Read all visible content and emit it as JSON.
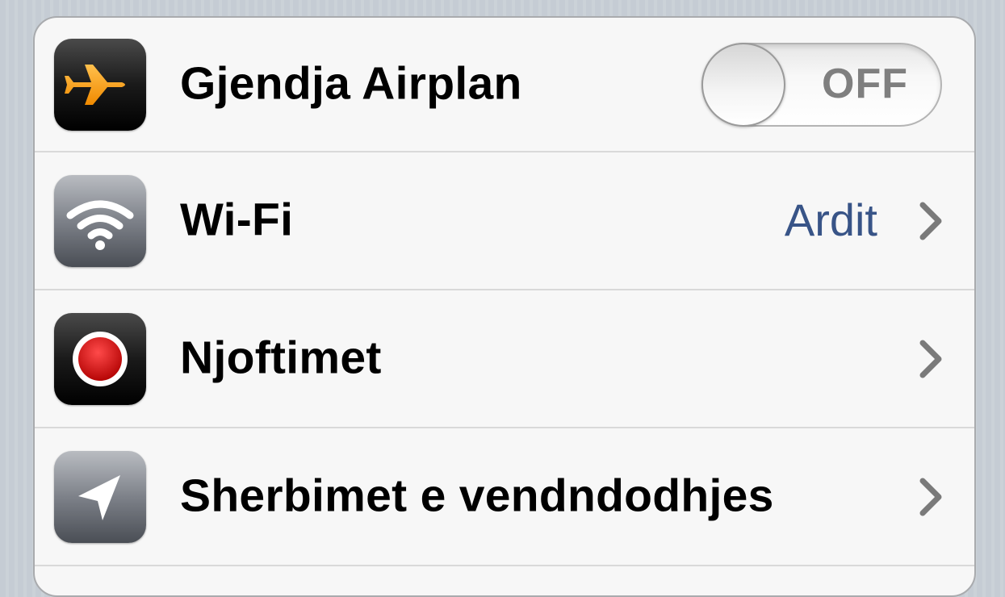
{
  "settings": {
    "rows": [
      {
        "label": "Gjendja Airplan",
        "icon": "airplane-icon",
        "control": "toggle",
        "toggle_state_label": "OFF",
        "toggle_on": false
      },
      {
        "label": "Wi-Fi",
        "icon": "wifi-icon",
        "detail": "Ardit",
        "control": "disclosure"
      },
      {
        "label": "Njoftimet",
        "icon": "notifications-icon",
        "control": "disclosure"
      },
      {
        "label": "Sherbimet e vendndodhjes",
        "icon": "location-arrow-icon",
        "control": "disclosure"
      }
    ]
  },
  "colors": {
    "detail_text": "#385487",
    "airplane_orange": "#f5a623",
    "notification_red": "#d0021b"
  }
}
